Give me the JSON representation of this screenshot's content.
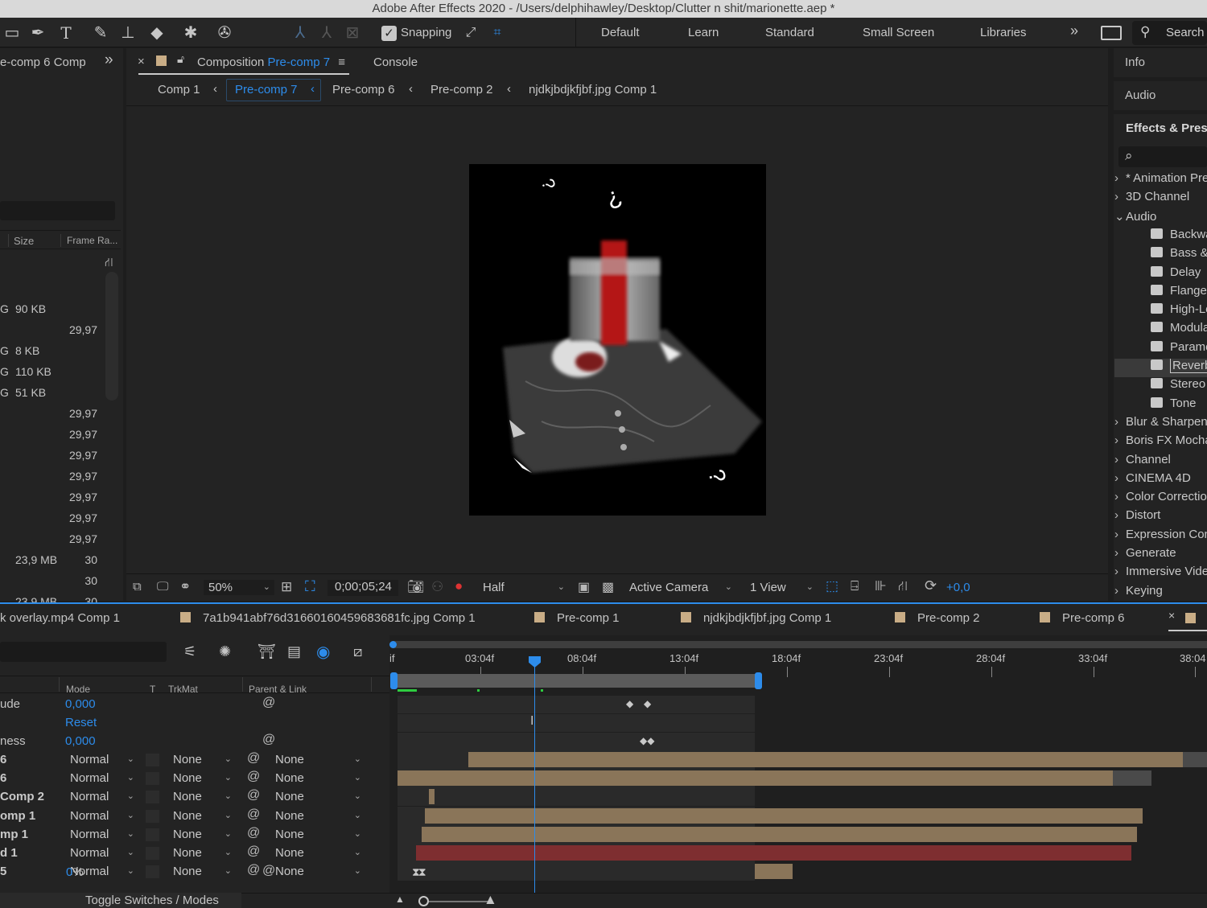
{
  "title": "Adobe After Effects 2020 - /Users/delphihawley/Desktop/Clutter n shit/marionette.aep *",
  "toolbar": {
    "snapping_label": "Snapping",
    "workspaces": [
      "Default",
      "Learn",
      "Standard",
      "Small Screen",
      "Libraries"
    ],
    "search_label": "Search",
    "more_glyph": "»"
  },
  "project": {
    "tab_label": "e-comp 6 Comp",
    "more_glyph": "»",
    "col_size": "Size",
    "col_framerate": "Frame Ra...",
    "rows": [
      {
        "pre": "G",
        "size": "90 KB",
        "fr": ""
      },
      {
        "pre": "",
        "size": "",
        "fr": "29,97"
      },
      {
        "pre": "G",
        "size": "8 KB",
        "fr": ""
      },
      {
        "pre": "G",
        "size": "110 KB",
        "fr": ""
      },
      {
        "pre": "G",
        "size": "51 KB",
        "fr": ""
      },
      {
        "pre": "",
        "size": "",
        "fr": "29,97"
      },
      {
        "pre": "",
        "size": "",
        "fr": "29,97"
      },
      {
        "pre": "",
        "size": "",
        "fr": "29,97"
      },
      {
        "pre": "",
        "size": "",
        "fr": "29,97"
      },
      {
        "pre": "",
        "size": "",
        "fr": "29,97"
      },
      {
        "pre": "",
        "size": "",
        "fr": "29,97"
      },
      {
        "pre": "",
        "size": "",
        "fr": "29,97"
      },
      {
        "pre": "",
        "size": "23,9 MB",
        "fr": "30"
      },
      {
        "pre": "",
        "size": "",
        "fr": "30"
      },
      {
        "pre": "",
        "size": "23,9 MB",
        "fr": "30"
      },
      {
        "pre": "",
        "size": "",
        "fr": "30"
      }
    ]
  },
  "composition": {
    "close_glyph": "×",
    "tab_prefix": "Composition",
    "tab_name": "Pre-comp 7",
    "menu_glyph": "≡",
    "console_tab": "Console",
    "breadcrumbs": [
      "Comp 1",
      "Pre-comp 7",
      "Pre-comp 6",
      "Pre-comp 2",
      "njdkjbdjkfjbf.jpg Comp 1"
    ],
    "breadcrumb_sep": "‹",
    "viewer_symbols": [
      "?",
      "?",
      "?"
    ],
    "footer": {
      "zoom": "50%",
      "timecode": "0;00;05;24",
      "resolution": "Half",
      "camera": "Active Camera",
      "views": "1 View",
      "exposure": "+0,0"
    }
  },
  "right": {
    "info": "Info",
    "audio": "Audio",
    "effects": "Effects & Presets",
    "search_glyph": "⌕",
    "categories_top": [
      {
        "label": "* Animation Presets",
        "open": false
      },
      {
        "label": "3D Channel",
        "open": false
      },
      {
        "label": "Audio",
        "open": true
      }
    ],
    "audio_effects": [
      "Backwards",
      "Bass & Treble",
      "Delay",
      "Flange & Chorus",
      "High-Low Pass",
      "Modulator",
      "Parametric EQ",
      "Reverb",
      "Stereo Mixer",
      "Tone"
    ],
    "categories_bottom": [
      "Blur & Sharpen",
      "Boris FX Mocha",
      "Channel",
      "CINEMA 4D",
      "Color Correction",
      "Distort",
      "Expression Controls",
      "Generate",
      "Immersive Video",
      "Keying"
    ],
    "collapsed_glyph": "›",
    "expanded_glyph": "⌄"
  },
  "timeline": {
    "tabs": [
      "k overlay.mp4 Comp 1",
      "7a1b941abf76d31660160459683681fc.jpg Comp 1",
      "Pre-comp 1",
      "njdkjbdjkfjbf.jpg Comp 1",
      "Pre-comp 2",
      "Pre-comp 6"
    ],
    "close_glyph": "×",
    "col_mode": "Mode",
    "col_t": "T",
    "col_trkmat": "TrkMat",
    "col_parent": "Parent & Link",
    "ruler": [
      "if",
      "03:04f",
      "08:04f",
      "13:04f",
      "18:04f",
      "23:04f",
      "28:04f",
      "33:04f",
      "38:04"
    ],
    "prop_rows": [
      {
        "name": "ude",
        "value": "0,000"
      },
      {
        "name": "",
        "value": "Reset"
      },
      {
        "name": "ness",
        "value": "0,000"
      }
    ],
    "layers": [
      {
        "name": "6",
        "mode": "Normal",
        "trkmat": "None",
        "parent": "None",
        "color": "#8a7559"
      },
      {
        "name": "6",
        "mode": "Normal",
        "trkmat": "None",
        "parent": "None",
        "color": "#8a7559"
      },
      {
        "name": "Comp 2",
        "mode": "Normal",
        "trkmat": "None",
        "parent": "None",
        "color": "#8a7559"
      },
      {
        "name": "omp 1",
        "mode": "Normal",
        "trkmat": "None",
        "parent": "None",
        "color": "#8a7559"
      },
      {
        "name": "mp 1",
        "mode": "Normal",
        "trkmat": "None",
        "parent": "None",
        "color": "#8a7559"
      },
      {
        "name": "d 1",
        "mode": "Normal",
        "trkmat": "None",
        "parent": "None",
        "color": "#7e2e30"
      },
      {
        "name": "5",
        "mode": "Normal",
        "trkmat": "None",
        "parent": "None",
        "color": "#8a7559"
      }
    ],
    "percent_row": {
      "value": "0",
      "unit": "%"
    },
    "toggle_label": "Toggle Switches / Modes"
  },
  "colors": {
    "accent": "#2d8ceb",
    "layer_tan": "#8a7559",
    "layer_red": "#7e2e30",
    "label_swatch": "#c9ad86"
  }
}
